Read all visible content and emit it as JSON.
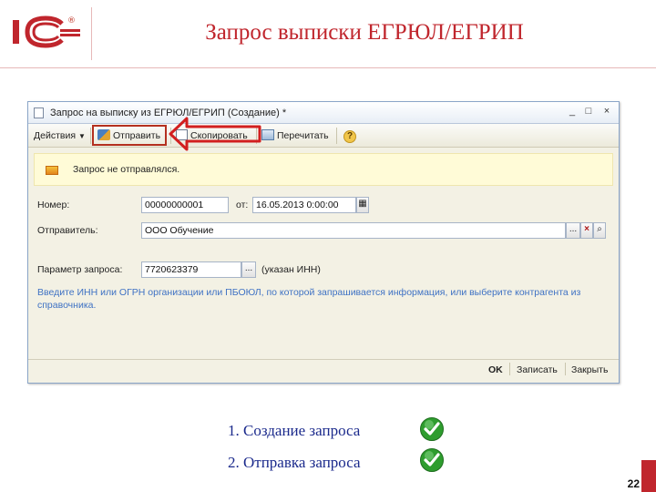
{
  "slide": {
    "title": "Запрос выписки ЕГРЮЛ/ЕГРИП",
    "page_number": "22",
    "logo_text": "1С",
    "logo_mark": "®"
  },
  "window": {
    "title": "Запрос на выписку из ЕГРЮЛ/ЕГРИП (Создание) *",
    "controls": {
      "minimize": "_",
      "maximize": "□",
      "close": "×"
    }
  },
  "toolbar": {
    "actions_label": "Действия",
    "send_label": "Отправить",
    "copy_label": "Скопировать",
    "reread_label": "Перечитать",
    "help_label": "?"
  },
  "notice": {
    "text": "Запрос не отправлялся."
  },
  "form": {
    "number_label": "Номер:",
    "number_value": "00000000001",
    "date_label": "от:",
    "date_value": "16.05.2013  0:00:00",
    "sender_label": "Отправитель:",
    "sender_value": "ООО Обучение",
    "param_label": "Параметр запроса:",
    "param_value": "7720623379",
    "param_note": "(указан ИНН)",
    "select_btn": "...",
    "clear_btn": "×",
    "hint": "Введите ИНН или ОГРН организации или ПБОЮЛ, по которой запрашивается информация, или выберите контрагента из справочника."
  },
  "footer": {
    "ok": "OK",
    "save": "Записать",
    "close": "Закрыть"
  },
  "steps": [
    {
      "text": "1. Создание запроса"
    },
    {
      "text": "2. Отправка запроса"
    }
  ],
  "colors": {
    "accent_red": "#c0262d",
    "step_blue": "#1b2a8c",
    "check_green": "#2e9d2e",
    "hint_blue": "#3f72c4"
  }
}
